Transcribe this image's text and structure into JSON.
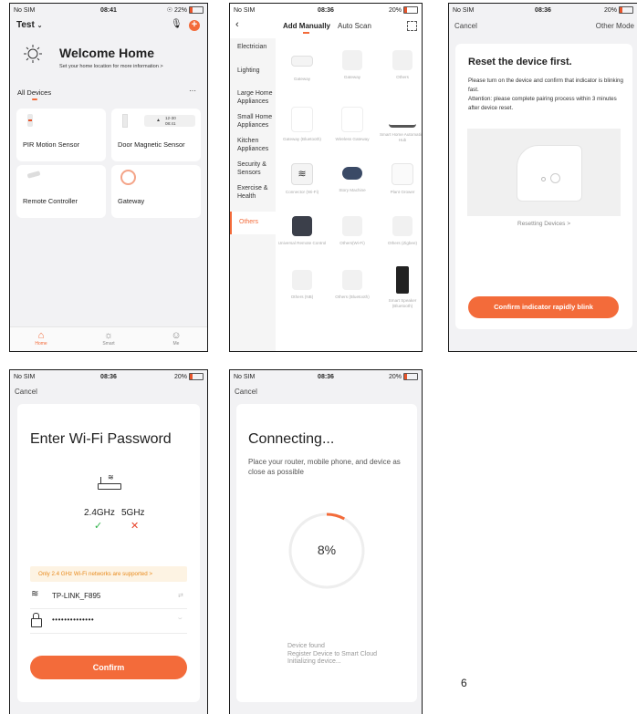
{
  "screen1": {
    "status": {
      "carrier": "No SIM",
      "time": "08:41",
      "battery": "22%"
    },
    "home_name": "Test",
    "welcome_title": "Welcome Home",
    "welcome_sub": "Set your home location for more information >",
    "section": "All Devices",
    "more": "···",
    "devices": [
      {
        "name": "PIR Motion Sensor"
      },
      {
        "name": "Door Magnetic Sensor",
        "badge_line1": "12-30",
        "badge_line2": "08:41"
      },
      {
        "name": "Remote Controller"
      },
      {
        "name": "Gateway"
      }
    ],
    "tabs": [
      {
        "label": "Home"
      },
      {
        "label": "Smart"
      },
      {
        "label": "Me"
      }
    ]
  },
  "screen2": {
    "status": {
      "carrier": "No SIM",
      "time": "08:36",
      "battery": "20%"
    },
    "tab_manual": "Add Manually",
    "tab_scan": "Auto Scan",
    "categories": [
      "Electrician",
      "Lighting",
      "Large Home Appliances",
      "Small Home Appliances",
      "Kitchen Appliances",
      "Security & Sensors",
      "Exercise & Health",
      "Others"
    ],
    "items": [
      {
        "label": "Gateway"
      },
      {
        "label": "Gateway"
      },
      {
        "label": "Others"
      },
      {
        "label": "Gateway (Bluetooth)"
      },
      {
        "label": "Wireless Gateway"
      },
      {
        "label": "Smart Home Automation Hub"
      },
      {
        "label": "Connector (Wi-Fi)"
      },
      {
        "label": "Story Machine"
      },
      {
        "label": "Plant Grower"
      },
      {
        "label": "Universal Remote Control"
      },
      {
        "label": "Others(Wi-Fi)"
      },
      {
        "label": "Others (Zigbee)"
      },
      {
        "label": "Others (NB)"
      },
      {
        "label": "Others (Bluetooth)"
      },
      {
        "label": "Smart Speaker (Bluetooth)"
      }
    ]
  },
  "screen3": {
    "status": {
      "carrier": "No SIM",
      "time": "08:36",
      "battery": "20%"
    },
    "cancel": "Cancel",
    "other_mode": "Other Mode",
    "title": "Reset the device first.",
    "desc1": "Please turn on the device and confirm that indicator is blinking fast.",
    "desc2": "Attention: please complete pairing process within 3 minutes after device reset.",
    "resetting_link": "Resetting Devices >",
    "confirm_btn": "Confirm indicator rapidly blink"
  },
  "screen4": {
    "status": {
      "carrier": "No SIM",
      "time": "08:36",
      "battery": "20%"
    },
    "cancel": "Cancel",
    "title": "Enter Wi-Fi Password",
    "band_24": "2.4GHz",
    "band_5": "5GHz",
    "notice": "Only 2.4 GHz Wi-Fi networks are supported >",
    "ssid": "TP-LINK_F895",
    "password_mask": "••••••••••••••",
    "confirm_btn": "Confirm"
  },
  "screen5": {
    "status": {
      "carrier": "No SIM",
      "time": "08:36",
      "battery": "20%"
    },
    "cancel": "Cancel",
    "title": "Connecting...",
    "desc": "Place your router, mobile phone, and device as close as possible",
    "progress_text": "8%",
    "progress_value": 0.08,
    "steps": [
      "Device found",
      "Register Device to Smart Cloud",
      "Initializing device..."
    ]
  },
  "page_number": "6",
  "colors": {
    "accent": "#f36b3a",
    "check": "#2fb34a",
    "cross": "#e8452c"
  }
}
